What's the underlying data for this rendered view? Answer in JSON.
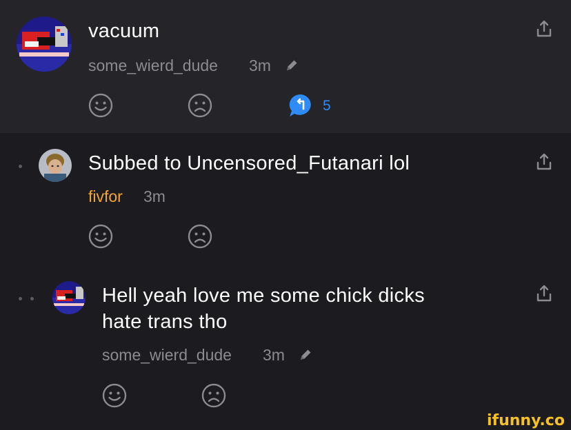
{
  "comments": [
    {
      "text": "vacuum",
      "username": "some_wierd_dude",
      "time": "3m",
      "reply_count": "5",
      "icons": [
        "pencil-icon",
        "smile-icon",
        "frown-icon",
        "reply-bubble-icon",
        "share-icon"
      ]
    },
    {
      "text": "Subbed to Uncensored_Futanari lol",
      "username": "fivfor",
      "time": "3m",
      "icons": [
        "smile-icon",
        "frown-icon",
        "share-icon"
      ]
    },
    {
      "text_line1": "Hell yeah love me some chick dicks",
      "text_line2": "hate trans tho",
      "username": "some_wierd_dude",
      "time": "3m",
      "icons": [
        "pencil-icon",
        "smile-icon",
        "frown-icon",
        "share-icon"
      ]
    }
  ],
  "watermark": "ifunny.co",
  "colors": {
    "background": "#1b1b20",
    "top_comment_background": "#242429",
    "meta_gray": "#8b8b92",
    "username_orange": "#f2a633",
    "reply_blue": "#2f8cf7",
    "watermark_yellow": "#f5c125"
  }
}
